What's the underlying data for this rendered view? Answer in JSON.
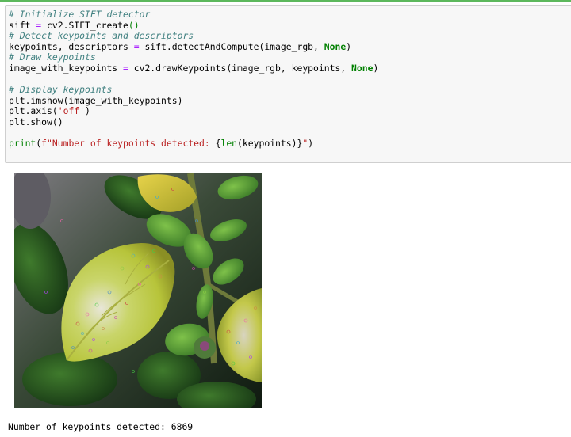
{
  "notebook": {
    "cell": {
      "lines": [
        [
          {
            "t": "# Initialize SIFT detector",
            "c": "comment"
          }
        ],
        [
          {
            "t": "sift "
          },
          {
            "t": "=",
            "c": "op"
          },
          {
            "t": " cv2.SIFT_create"
          },
          {
            "t": "()",
            "c": "paren"
          }
        ],
        [
          {
            "t": "# Detect keypoints and descriptors",
            "c": "comment"
          }
        ],
        [
          {
            "t": "keypoints, descriptors "
          },
          {
            "t": "=",
            "c": "op"
          },
          {
            "t": " sift.detectAndCompute(image_rgb, "
          },
          {
            "t": "None",
            "c": "kw"
          },
          {
            "t": ")"
          }
        ],
        [
          {
            "t": "# Draw keypoints",
            "c": "comment"
          }
        ],
        [
          {
            "t": "image_with_keypoints "
          },
          {
            "t": "=",
            "c": "op"
          },
          {
            "t": " cv2.drawKeypoints(image_rgb, keypoints, "
          },
          {
            "t": "None",
            "c": "kw"
          },
          {
            "t": ")"
          }
        ],
        [],
        [
          {
            "t": "# Display keypoints",
            "c": "comment"
          }
        ],
        [
          {
            "t": "plt.imshow(image_with_keypoints)"
          }
        ],
        [
          {
            "t": "plt.axis("
          },
          {
            "t": "'off'",
            "c": "str"
          },
          {
            "t": ")"
          }
        ],
        [
          {
            "t": "plt.show()"
          }
        ],
        [],
        [
          {
            "t": "print",
            "c": "builtin"
          },
          {
            "t": "("
          },
          {
            "t": "f\"Number of keypoints detected: ",
            "c": "str"
          },
          {
            "t": "{"
          },
          {
            "t": "len",
            "c": "builtin"
          },
          {
            "t": "(keypoints)"
          },
          {
            "t": "}"
          },
          {
            "t": "\"",
            "c": "str"
          },
          {
            "t": ")"
          }
        ]
      ]
    },
    "output": {
      "image_alt": "Leaves with detected SIFT keypoints",
      "stdout": "Number of keypoints detected: 6869"
    }
  },
  "colors": {
    "cell_background": "#f7f7f7",
    "cell_border": "#cfcfcf",
    "selection_bar": "#5cb85c",
    "comment": "#408080",
    "operator": "#aa22ff",
    "keyword": "#008000",
    "string": "#ba2121"
  }
}
